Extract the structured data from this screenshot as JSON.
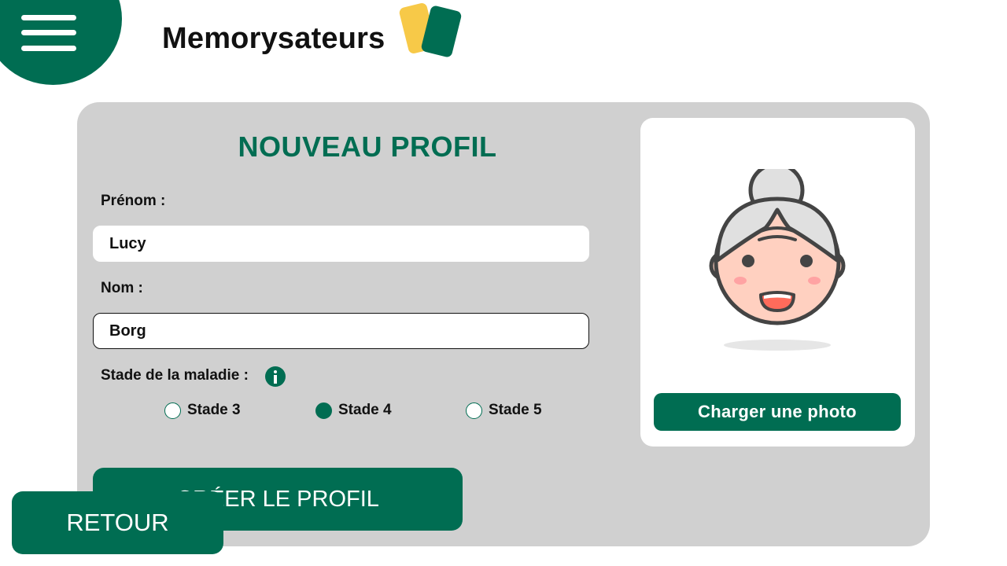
{
  "header": {
    "brand": "Memorysateurs",
    "menu_icon": "hamburger-menu-icon",
    "logo_icon": "cards-logo-icon"
  },
  "form": {
    "title": "NOUVEAU PROFIL",
    "first_name_label": "Prénom :",
    "first_name_value": "Lucy",
    "last_name_label": "Nom :",
    "last_name_value": "Borg",
    "stage_label": "Stade de la maladie :",
    "info_icon": "info-icon",
    "stages": [
      {
        "label": "Stade 3",
        "checked": false
      },
      {
        "label": "Stade 4",
        "checked": true
      },
      {
        "label": "Stade 5",
        "checked": false
      }
    ]
  },
  "photo": {
    "avatar_icon": "grandmother-avatar-icon",
    "upload_label": "Charger une photo"
  },
  "actions": {
    "create_label": "CRÉER LE PROFIL",
    "back_label": "RETOUR"
  },
  "colors": {
    "accent": "#006d52",
    "card_bg": "#d0d0d0",
    "logo_yellow": "#f7c948"
  }
}
